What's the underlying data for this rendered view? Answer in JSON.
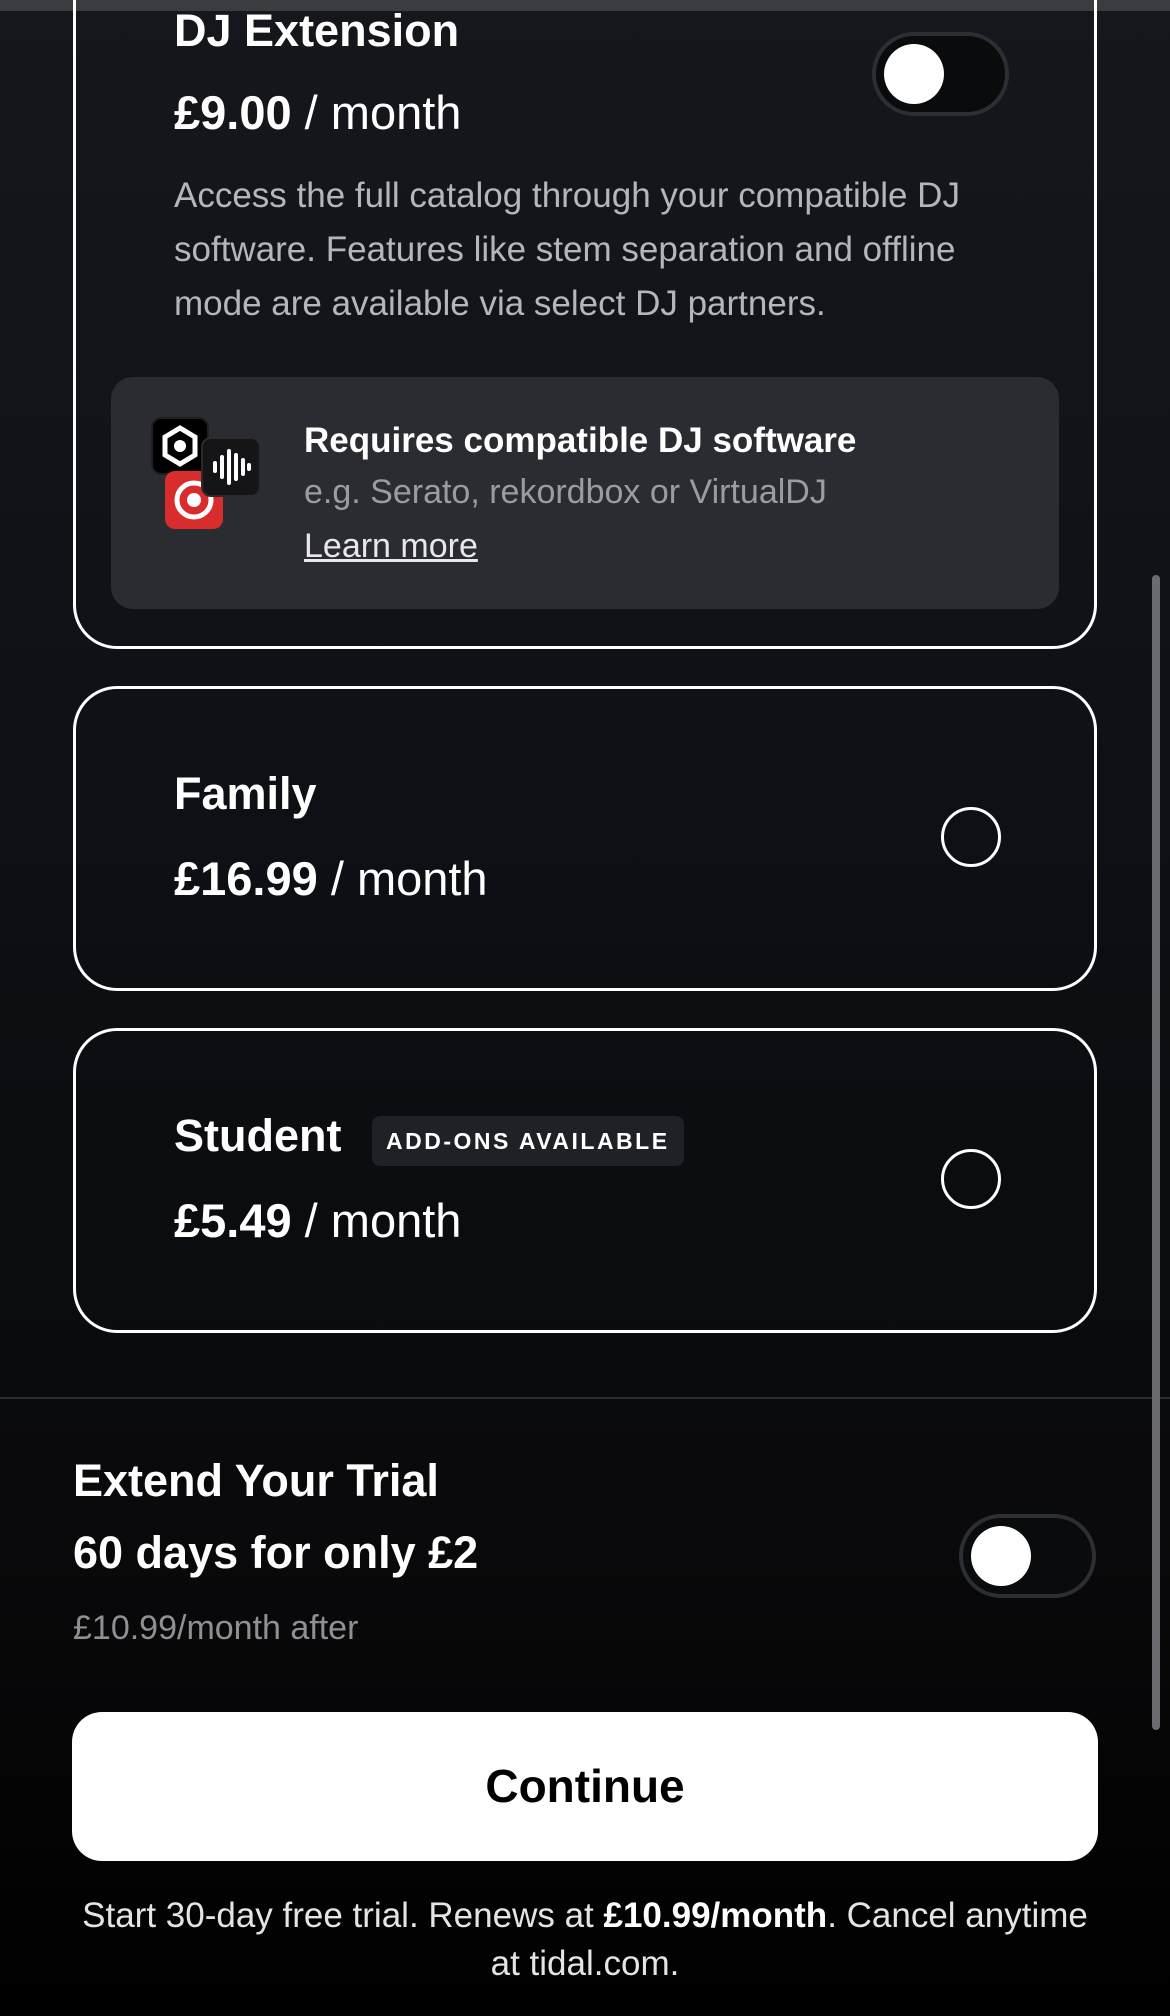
{
  "plans": {
    "dj": {
      "title": "DJ Extension",
      "price": "£9.00",
      "period": " / month",
      "description": "Access the full catalog through your compatible DJ software. Features like stem separation and offline mode are available via select DJ partners.",
      "toggle_on": false,
      "requirement": {
        "title": "Requires compatible DJ software",
        "subtitle": "e.g. Serato, rekordbox or VirtualDJ",
        "link": "Learn more",
        "icons": [
          "rekordbox-icon",
          "virtualdj-icon",
          "serato-icon"
        ]
      }
    },
    "family": {
      "title": "Family",
      "price": "£16.99",
      "period": " / month",
      "selected": false
    },
    "student": {
      "title": "Student",
      "badge": "ADD-ONS AVAILABLE",
      "price": "£5.49",
      "period": " / month",
      "selected": false
    }
  },
  "trial": {
    "title": "Extend Your Trial",
    "subtitle": "60 days for only £2",
    "note": "£10.99/month after",
    "toggle_on": false
  },
  "continue_label": "Continue",
  "footer": {
    "prefix": "Start 30-day free trial. Renews at ",
    "price": "£10.99/month",
    "suffix": ". Cancel anytime at tidal.com."
  },
  "colors": {
    "background": "#0b0d11",
    "card_border": "#ffffff",
    "info_box": "#2a2c31",
    "serato_red": "#d92c2c"
  }
}
